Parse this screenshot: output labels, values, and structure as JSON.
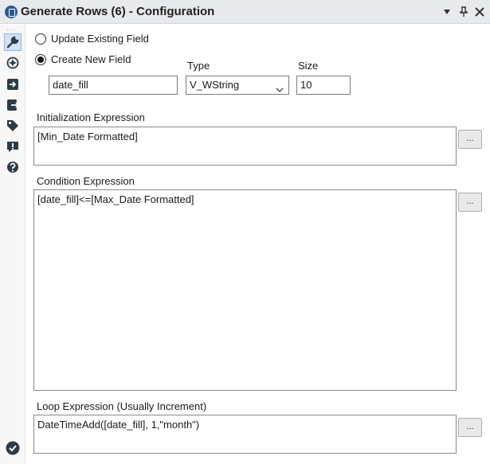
{
  "window": {
    "title": "Generate Rows (6) - Configuration",
    "controls": {
      "dropdown_icon": "caret-down-icon",
      "pin_icon": "pin-icon",
      "close_icon": "close-icon"
    }
  },
  "sidebar": {
    "items": [
      {
        "name": "configuration-wrench",
        "icon": "wrench-icon",
        "selected": true
      },
      {
        "name": "layout-compass",
        "icon": "compass-icon"
      },
      {
        "name": "input-arrow",
        "icon": "input-arrow-icon"
      },
      {
        "name": "output-arrow",
        "icon": "output-arrow-icon"
      },
      {
        "name": "tag",
        "icon": "tag-icon"
      },
      {
        "name": "comment",
        "icon": "comment-alert-icon"
      },
      {
        "name": "help",
        "icon": "help-icon"
      }
    ],
    "bottom_icon": "checkmark-icon"
  },
  "form": {
    "update_existing_label": "Update Existing Field",
    "create_new_label": "Create New  Field",
    "create_new_selected": true,
    "type_label": "Type",
    "size_label": "Size",
    "field_name_value": "date_fill",
    "type_value": "V_WString",
    "size_value": "10",
    "init_label": "Initialization Expression",
    "init_value": "[Min_Date Formatted]",
    "condition_label": "Condition Expression",
    "condition_value": "[date_fill]<=[Max_Date Formatted]",
    "loop_label": "Loop Expression (Usually Increment)",
    "loop_value": "DateTimeAdd([date_fill], 1,\"month\")",
    "ellipsis_label": "..."
  },
  "colors": {
    "title_bg": "#e7e9ec",
    "icon_dark": "#2d3b45",
    "selected_bg": "#cfe3f7",
    "check_green": "#2d3b45"
  }
}
